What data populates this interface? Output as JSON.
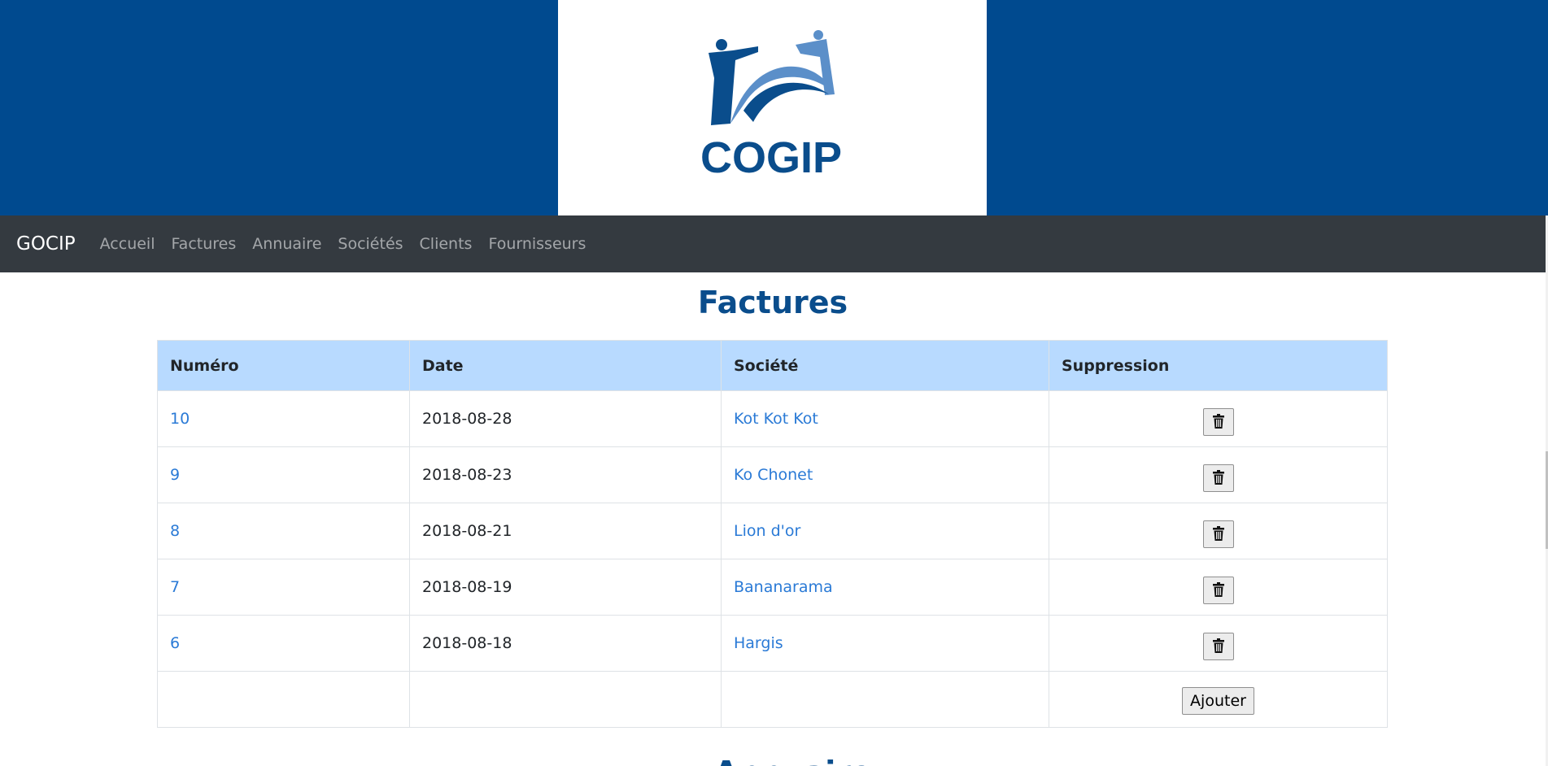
{
  "header": {
    "logo_text": "COGIP",
    "colors": {
      "banner": "#004a8f",
      "logo_dark": "#0a4d8c",
      "logo_light": "#5b8fc9"
    }
  },
  "navbar": {
    "brand": "GOCIP",
    "items": [
      {
        "label": "Accueil"
      },
      {
        "label": "Factures"
      },
      {
        "label": "Annuaire"
      },
      {
        "label": "Sociétés"
      },
      {
        "label": "Clients"
      },
      {
        "label": "Fournisseurs"
      }
    ]
  },
  "main": {
    "title": "Factures",
    "table": {
      "columns": [
        "Numéro",
        "Date",
        "Société",
        "Suppression"
      ],
      "rows": [
        {
          "numero": "10",
          "date": "2018-08-28",
          "societe": "Kot Kot Kot"
        },
        {
          "numero": "9",
          "date": "2018-08-23",
          "societe": "Ko Chonet"
        },
        {
          "numero": "8",
          "date": "2018-08-21",
          "societe": "Lion d'or"
        },
        {
          "numero": "7",
          "date": "2018-08-19",
          "societe": "Bananarama"
        },
        {
          "numero": "6",
          "date": "2018-08-18",
          "societe": "Hargis"
        }
      ],
      "delete_icon": "trash-icon",
      "add_label": "Ajouter"
    },
    "next_section_title": "Annuaire"
  }
}
